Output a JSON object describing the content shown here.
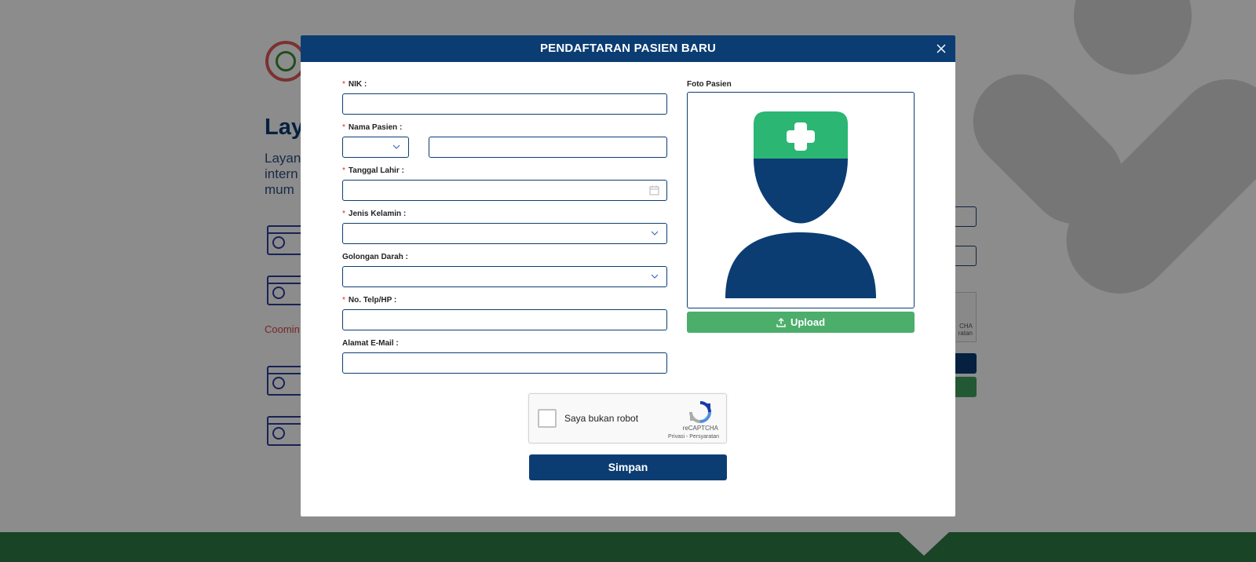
{
  "background": {
    "heading": "Lay",
    "description_lines": [
      "Layan",
      "intern",
      "mum"
    ],
    "coming_text": "Coomin",
    "captcha_fragment": "CHA",
    "captcha_fragment2": "ratan"
  },
  "modal": {
    "title": "PENDAFTARAN PASIEN BARU",
    "close_label": "X",
    "fields": {
      "nik": {
        "label": "NIK :",
        "required": "*"
      },
      "nama": {
        "label": "Nama Pasien :",
        "required": "*"
      },
      "tanggal": {
        "label": "Tanggal Lahir :",
        "required": "*"
      },
      "kelamin": {
        "label": "Jenis Kelamin :",
        "required": "*"
      },
      "darah": {
        "label": "Golongan Darah :"
      },
      "telp": {
        "label": "No. Telp/HP :",
        "required": "*"
      },
      "email": {
        "label": "Alamat E-Mail :"
      }
    },
    "photo": {
      "label": "Foto Pasien",
      "upload_label": "Upload",
      "upload_icon": "upload-icon",
      "avatar_colors": {
        "cap": "#2bb673",
        "body": "#0b3d73"
      }
    },
    "captcha": {
      "label": "Saya bukan robot",
      "brand": "reCAPTCHA",
      "links": "Privasi - Persyaratan"
    },
    "save_label": "Simpan"
  },
  "colors": {
    "primary": "#0b3d73",
    "upload_green": "#4cae6b",
    "required_red": "#e02424",
    "footer_green": "#2e7d46"
  }
}
